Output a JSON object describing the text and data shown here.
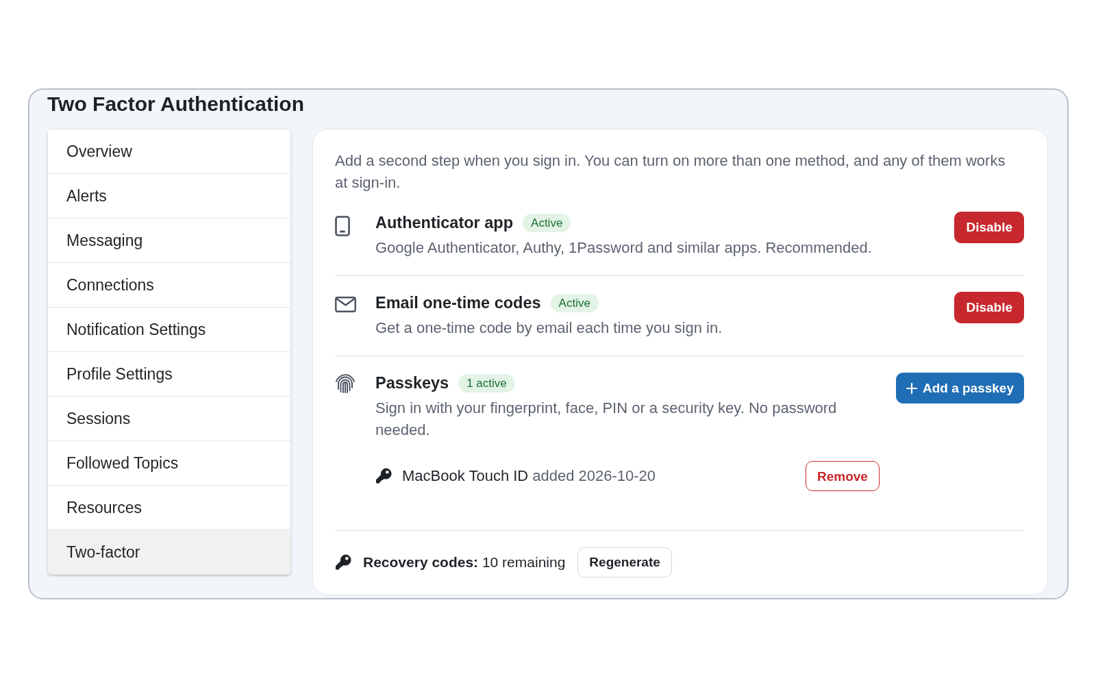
{
  "page": {
    "title": "Two Factor Authentication"
  },
  "sidebar": {
    "items": [
      {
        "label": "Overview",
        "selected": false
      },
      {
        "label": "Alerts",
        "selected": false
      },
      {
        "label": "Messaging",
        "selected": false
      },
      {
        "label": "Connections",
        "selected": false
      },
      {
        "label": "Notification Settings",
        "selected": false
      },
      {
        "label": "Profile Settings",
        "selected": false
      },
      {
        "label": "Sessions",
        "selected": false
      },
      {
        "label": "Followed Topics",
        "selected": false
      },
      {
        "label": "Resources",
        "selected": false
      },
      {
        "label": "Two-factor",
        "selected": true
      }
    ]
  },
  "intro": "Add a second step when you sign in. You can turn on more than one method, and any of them works at sign-in.",
  "methods": [
    {
      "kind": "app",
      "title": "Authenticator app",
      "badge": "Active",
      "description": "Google Authenticator, Authy, 1Password and similar apps. Recommended.",
      "button": {
        "kind": "danger",
        "label": "Disable"
      }
    },
    {
      "kind": "email",
      "title": "Email one-time codes",
      "badge": "Active",
      "description": "Get a one-time code by email each time you sign in.",
      "button": {
        "kind": "danger",
        "label": "Disable"
      }
    },
    {
      "kind": "passkey",
      "title": "Passkeys",
      "badge": "1 active",
      "description": "Sign in with your fingerprint, face, PIN or a security key. No password needed.",
      "button": {
        "kind": "add",
        "label": "Add a passkey"
      },
      "keys": [
        {
          "name": "MacBook Touch ID",
          "added": "added 2026-10-20",
          "action": "Remove"
        }
      ]
    }
  ],
  "recovery": {
    "text": "**Recovery codes:** 10 remaining",
    "button": "Regenerate"
  }
}
